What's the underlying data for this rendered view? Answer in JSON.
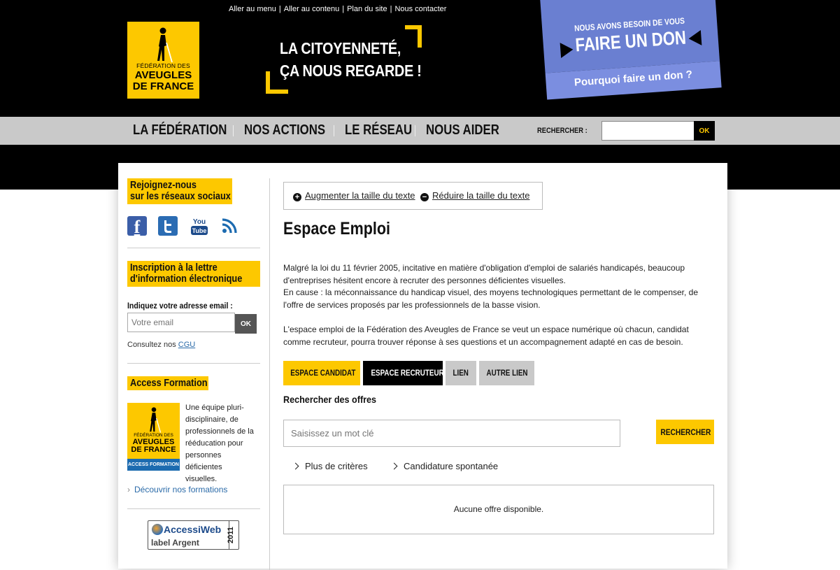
{
  "header": {
    "skip_links": [
      "Aller au menu",
      "Aller au contenu",
      "Plan du site",
      "Nous contacter"
    ],
    "logo": {
      "line1": "FÉDÉRATION DES",
      "line2": "AVEUGLES",
      "line3": "DE FRANCE"
    },
    "slogan": {
      "line1": "LA CITOYENNETÉ,",
      "line2": "ÇA NOUS REGARDE !"
    },
    "donation": {
      "need": "NOUS AVONS BESOIN DE VOUS",
      "cta": "FAIRE UN DON",
      "why": "Pourquoi faire un don ?"
    }
  },
  "nav": {
    "items": [
      "LA FÉDÉRATION",
      "NOS ACTIONS",
      "LE RÉSEAU",
      "NOUS AIDER"
    ],
    "search_label": "RECHERCHER :",
    "search_value": "",
    "search_button": "OK"
  },
  "sidebar": {
    "social_title_1": "Rejoignez-nous",
    "social_title_2": "sur les réseaux sociaux",
    "social_icons": [
      "facebook-icon",
      "twitter-icon",
      "youtube-icon",
      "rss-icon"
    ],
    "youtube_you": "You",
    "youtube_tube": "Tube",
    "facebook_glyph": "f",
    "newsletter_title_1": "Inscription à la lettre",
    "newsletter_title_2": "d'information électronique",
    "email_label": "Indiquez votre adresse email :",
    "email_placeholder": "Votre email",
    "email_button": "OK",
    "cgu_prefix": "Consultez nos ",
    "cgu_link": "CGU",
    "formation_title": "Access Formation",
    "formation_logo": {
      "line1": "FÉDÉRATION DES",
      "line2": "AVEUGLES",
      "line3": "DE FRANCE",
      "band": "ACCESS FORMATION"
    },
    "formation_desc": "Une équipe pluri-disciplinaire, de professionnels de la rééducation pour personnes déficientes visuelles.",
    "formation_link": "Découvrir nos formations",
    "label": {
      "name": "AccessiWeb",
      "level": "label Argent",
      "year": "2011"
    }
  },
  "main": {
    "text_increase": "Augmenter la taille du texte",
    "text_decrease": "Réduire la taille du texte",
    "title": "Espace Emploi",
    "paragraph1": "Malgré la loi du 11 février 2005, incitative en matière d'obligation d'emploi de salariés handicapés, beaucoup d'entreprises hésitent encore à recruter des personnes déficientes visuelles.",
    "paragraph1b": "En cause : la méconnaissance du handicap visuel, des moyens technologiques permettant de le compenser, de l'offre de services proposés par les professionnels de la basse vision.",
    "paragraph2": "L'espace emploi de la Fédération des Aveugles de France se veut un espace numérique où chacun, candidat comme recruteur, pourra trouver réponse à ses questions et un accompagnement adapté en cas de besoin.",
    "tabs": [
      "ESPACE CANDIDAT",
      "ESPACE RECRUTEUR",
      "LIEN",
      "AUTRE LIEN"
    ],
    "search_title": "Rechercher des offres",
    "keyword_placeholder": "Saisissez un mot clé",
    "search_button": "RECHERCHER",
    "more_criteria": "Plus de critères",
    "spontaneous": "Candidature spontanée",
    "no_offer": "Aucune offre disponible."
  },
  "colors": {
    "brand_yellow": "#fdc800",
    "donation_blue": "#6a7fd1",
    "nav_gray": "#c9c9c9",
    "link_blue": "#2a6aa8"
  }
}
